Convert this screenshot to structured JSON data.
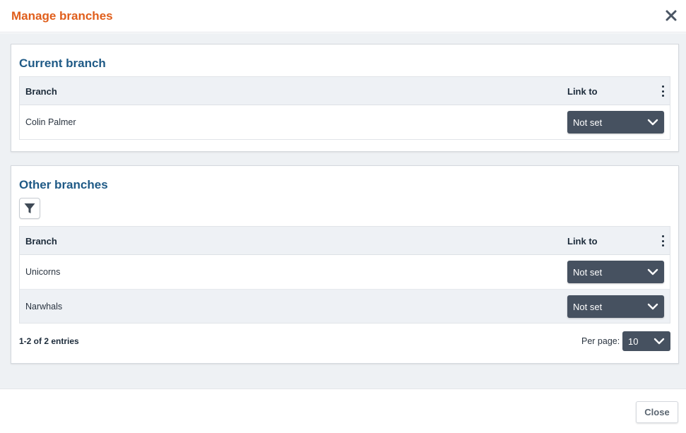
{
  "dialog": {
    "title": "Manage branches",
    "close_icon": "close-icon"
  },
  "current_branch": {
    "title": "Current branch",
    "columns": {
      "branch": "Branch",
      "link_to": "Link to"
    },
    "rows": [
      {
        "name": "Colin Palmer",
        "link_to": "Not set"
      }
    ]
  },
  "other_branches": {
    "title": "Other branches",
    "filter_icon": "filter-icon",
    "columns": {
      "branch": "Branch",
      "link_to": "Link to"
    },
    "rows": [
      {
        "name": "Unicorns",
        "link_to": "Not set"
      },
      {
        "name": "Narwhals",
        "link_to": "Not set"
      }
    ],
    "entries_info": "1-2 of 2 entries",
    "per_page_label": "Per page:",
    "per_page_value": "10"
  },
  "footer": {
    "close_label": "Close"
  },
  "colors": {
    "title_accent": "#e05e1b",
    "panel_title": "#1f5a86",
    "select_bg": "#465160"
  }
}
